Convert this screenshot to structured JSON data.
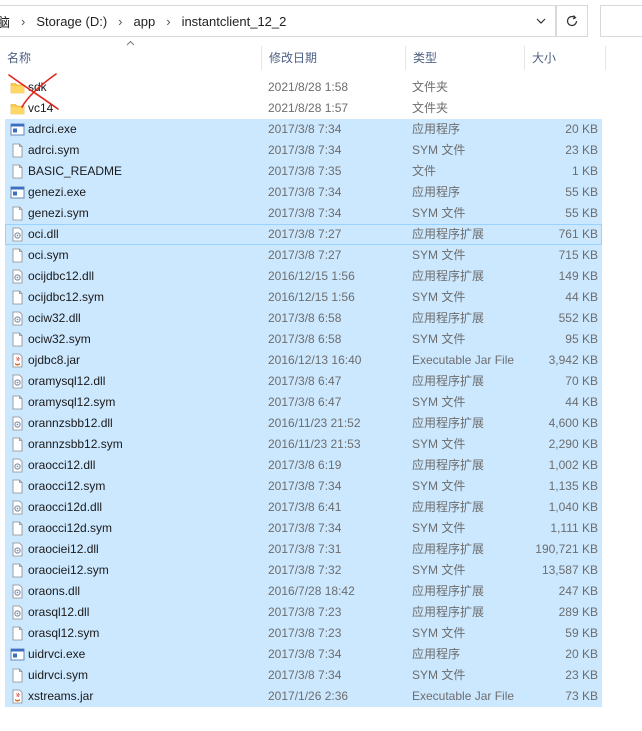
{
  "address": {
    "crumbs": [
      "脑",
      "Storage (D:)",
      "app",
      "instantclient_12_2"
    ],
    "separator": "›"
  },
  "columns": {
    "name": "名称",
    "date": "修改日期",
    "type": "类型",
    "size": "大小"
  },
  "files": [
    {
      "name": "sdk",
      "date": "2021/8/28 1:58",
      "type": "文件夹",
      "size": "",
      "icon": "folder-icon",
      "selected": false
    },
    {
      "name": "vc14",
      "date": "2021/8/28 1:57",
      "type": "文件夹",
      "size": "",
      "icon": "folder-icon",
      "selected": false
    },
    {
      "name": "adrci.exe",
      "date": "2017/3/8 7:34",
      "type": "应用程序",
      "size": "20 KB",
      "icon": "exe-icon",
      "selected": true
    },
    {
      "name": "adrci.sym",
      "date": "2017/3/8 7:34",
      "type": "SYM 文件",
      "size": "23 KB",
      "icon": "file-icon",
      "selected": true
    },
    {
      "name": "BASIC_README",
      "date": "2017/3/8 7:35",
      "type": "文件",
      "size": "1 KB",
      "icon": "file-icon",
      "selected": true
    },
    {
      "name": "genezi.exe",
      "date": "2017/3/8 7:34",
      "type": "应用程序",
      "size": "55 KB",
      "icon": "exe-icon",
      "selected": true
    },
    {
      "name": "genezi.sym",
      "date": "2017/3/8 7:34",
      "type": "SYM 文件",
      "size": "55 KB",
      "icon": "file-icon",
      "selected": true
    },
    {
      "name": "oci.dll",
      "date": "2017/3/8 7:27",
      "type": "应用程序扩展",
      "size": "761 KB",
      "icon": "dll-icon",
      "selected": true,
      "focus": true
    },
    {
      "name": "oci.sym",
      "date": "2017/3/8 7:27",
      "type": "SYM 文件",
      "size": "715 KB",
      "icon": "file-icon",
      "selected": true
    },
    {
      "name": "ocijdbc12.dll",
      "date": "2016/12/15 1:56",
      "type": "应用程序扩展",
      "size": "149 KB",
      "icon": "dll-icon",
      "selected": true
    },
    {
      "name": "ocijdbc12.sym",
      "date": "2016/12/15 1:56",
      "type": "SYM 文件",
      "size": "44 KB",
      "icon": "file-icon",
      "selected": true
    },
    {
      "name": "ociw32.dll",
      "date": "2017/3/8 6:58",
      "type": "应用程序扩展",
      "size": "552 KB",
      "icon": "dll-icon",
      "selected": true
    },
    {
      "name": "ociw32.sym",
      "date": "2017/3/8 6:58",
      "type": "SYM 文件",
      "size": "95 KB",
      "icon": "file-icon",
      "selected": true
    },
    {
      "name": "ojdbc8.jar",
      "date": "2016/12/13 16:40",
      "type": "Executable Jar File",
      "size": "3,942 KB",
      "icon": "jar-icon",
      "selected": true
    },
    {
      "name": "oramysql12.dll",
      "date": "2017/3/8 6:47",
      "type": "应用程序扩展",
      "size": "70 KB",
      "icon": "dll-icon",
      "selected": true
    },
    {
      "name": "oramysql12.sym",
      "date": "2017/3/8 6:47",
      "type": "SYM 文件",
      "size": "44 KB",
      "icon": "file-icon",
      "selected": true
    },
    {
      "name": "orannzsbb12.dll",
      "date": "2016/11/23 21:52",
      "type": "应用程序扩展",
      "size": "4,600 KB",
      "icon": "dll-icon",
      "selected": true
    },
    {
      "name": "orannzsbb12.sym",
      "date": "2016/11/23 21:53",
      "type": "SYM 文件",
      "size": "2,290 KB",
      "icon": "file-icon",
      "selected": true
    },
    {
      "name": "oraocci12.dll",
      "date": "2017/3/8 6:19",
      "type": "应用程序扩展",
      "size": "1,002 KB",
      "icon": "dll-icon",
      "selected": true
    },
    {
      "name": "oraocci12.sym",
      "date": "2017/3/8 7:34",
      "type": "SYM 文件",
      "size": "1,135 KB",
      "icon": "file-icon",
      "selected": true
    },
    {
      "name": "oraocci12d.dll",
      "date": "2017/3/8 6:41",
      "type": "应用程序扩展",
      "size": "1,040 KB",
      "icon": "dll-icon",
      "selected": true
    },
    {
      "name": "oraocci12d.sym",
      "date": "2017/3/8 7:34",
      "type": "SYM 文件",
      "size": "1,111 KB",
      "icon": "file-icon",
      "selected": true
    },
    {
      "name": "oraociei12.dll",
      "date": "2017/3/8 7:31",
      "type": "应用程序扩展",
      "size": "190,721 KB",
      "icon": "dll-icon",
      "selected": true
    },
    {
      "name": "oraociei12.sym",
      "date": "2017/3/8 7:32",
      "type": "SYM 文件",
      "size": "13,587 KB",
      "icon": "file-icon",
      "selected": true
    },
    {
      "name": "oraons.dll",
      "date": "2016/7/28 18:42",
      "type": "应用程序扩展",
      "size": "247 KB",
      "icon": "dll-icon",
      "selected": true
    },
    {
      "name": "orasql12.dll",
      "date": "2017/3/8 7:23",
      "type": "应用程序扩展",
      "size": "289 KB",
      "icon": "dll-icon",
      "selected": true
    },
    {
      "name": "orasql12.sym",
      "date": "2017/3/8 7:23",
      "type": "SYM 文件",
      "size": "59 KB",
      "icon": "file-icon",
      "selected": true
    },
    {
      "name": "uidrvci.exe",
      "date": "2017/3/8 7:34",
      "type": "应用程序",
      "size": "20 KB",
      "icon": "exe-icon",
      "selected": true
    },
    {
      "name": "uidrvci.sym",
      "date": "2017/3/8 7:34",
      "type": "SYM 文件",
      "size": "23 KB",
      "icon": "file-icon",
      "selected": true
    },
    {
      "name": "xstreams.jar",
      "date": "2017/1/26 2:36",
      "type": "Executable Jar File",
      "size": "73 KB",
      "icon": "jar-icon",
      "selected": true
    }
  ],
  "colors": {
    "selection": "#cce8ff",
    "focus_border": "#99d1ff",
    "header_text": "#4d6082",
    "folder": "#ffc83d",
    "annotation": "#e0281e"
  }
}
